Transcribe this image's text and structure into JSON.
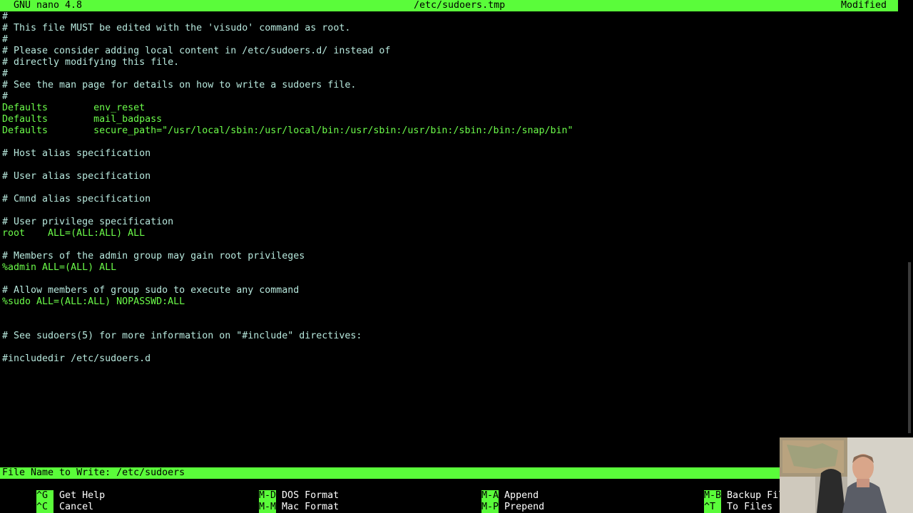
{
  "titlebar": {
    "version": "GNU nano 4.8",
    "filename": "/etc/sudoers.tmp",
    "status": "Modified"
  },
  "editor": {
    "lines": [
      {
        "text": "#",
        "type": "comment"
      },
      {
        "text": "# This file MUST be edited with the 'visudo' command as root.",
        "type": "comment"
      },
      {
        "text": "#",
        "type": "comment"
      },
      {
        "text": "# Please consider adding local content in /etc/sudoers.d/ instead of",
        "type": "comment"
      },
      {
        "text": "# directly modifying this file.",
        "type": "comment"
      },
      {
        "text": "#",
        "type": "comment"
      },
      {
        "text": "# See the man page for details on how to write a sudoers file.",
        "type": "comment"
      },
      {
        "text": "#",
        "type": "comment"
      },
      {
        "text": "Defaults        env_reset",
        "type": "code"
      },
      {
        "text": "Defaults        mail_badpass",
        "type": "code"
      },
      {
        "text": "Defaults        secure_path=\"/usr/local/sbin:/usr/local/bin:/usr/sbin:/usr/bin:/sbin:/bin:/snap/bin\"",
        "type": "code"
      },
      {
        "text": "",
        "type": "blank"
      },
      {
        "text": "# Host alias specification",
        "type": "comment"
      },
      {
        "text": "",
        "type": "blank"
      },
      {
        "text": "# User alias specification",
        "type": "comment"
      },
      {
        "text": "",
        "type": "blank"
      },
      {
        "text": "# Cmnd alias specification",
        "type": "comment"
      },
      {
        "text": "",
        "type": "blank"
      },
      {
        "text": "# User privilege specification",
        "type": "comment"
      },
      {
        "text": "root    ALL=(ALL:ALL) ALL",
        "type": "code"
      },
      {
        "text": "",
        "type": "blank"
      },
      {
        "text": "# Members of the admin group may gain root privileges",
        "type": "comment"
      },
      {
        "text": "%admin ALL=(ALL) ALL",
        "type": "code"
      },
      {
        "text": "",
        "type": "blank"
      },
      {
        "text": "# Allow members of group sudo to execute any command",
        "type": "comment"
      },
      {
        "text": "%sudo ALL=(ALL:ALL) NOPASSWD:ALL",
        "type": "code"
      },
      {
        "text": "",
        "type": "blank"
      },
      {
        "text": "",
        "type": "blank"
      },
      {
        "text": "# See sudoers(5) for more information on \"#include\" directives:",
        "type": "comment"
      },
      {
        "text": "",
        "type": "blank"
      },
      {
        "text": "#includedir /etc/sudoers.d",
        "type": "comment"
      }
    ]
  },
  "prompt": {
    "label": "File Name to Write: /etc/sudoers"
  },
  "shortcuts": [
    {
      "key": "^G",
      "label": " Get Help"
    },
    {
      "key": "M-D",
      "label": " DOS Format"
    },
    {
      "key": "M-A",
      "label": " Append"
    },
    {
      "key": "M-B",
      "label": " Backup File"
    },
    {
      "key": "^C",
      "label": " Cancel"
    },
    {
      "key": "M-M",
      "label": " Mac Format"
    },
    {
      "key": "M-P",
      "label": " Prepend"
    },
    {
      "key": "^T",
      "label": " To Files"
    }
  ],
  "colors": {
    "bar_green": "#5afc3a",
    "code_green": "#6cfc4a",
    "comment_cyan": "#b7e8dd",
    "background": "#000000"
  }
}
